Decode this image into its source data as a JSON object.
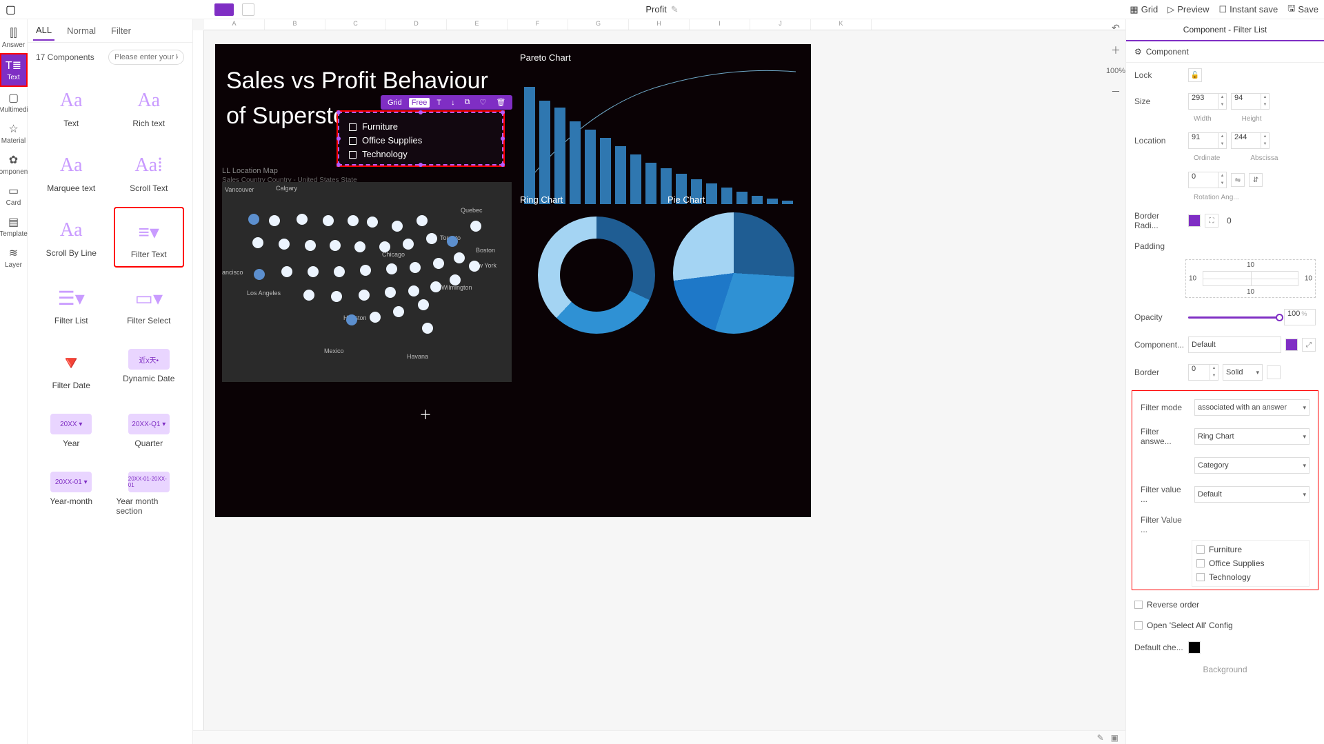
{
  "topbar": {
    "title": "Profit",
    "grid": "Grid",
    "preview": "Preview",
    "instant_save": "Instant save",
    "save": "Save"
  },
  "leftrail": {
    "answer": "Answer",
    "text": "Text",
    "multimedia": "Multimedi",
    "material": "Material",
    "component": "omponen",
    "card": "Card",
    "template": "Template",
    "layer": "Layer"
  },
  "leftpanel": {
    "tab_all": "ALL",
    "tab_normal": "Normal",
    "tab_filter": "Filter",
    "count": "17 Components",
    "search_placeholder": "Please enter your key",
    "items": [
      {
        "label": "Text"
      },
      {
        "label": "Rich text"
      },
      {
        "label": "Marquee text"
      },
      {
        "label": "Scroll Text"
      },
      {
        "label": "Scroll By Line"
      },
      {
        "label": "Filter Text"
      },
      {
        "label": "Filter List"
      },
      {
        "label": "Filter Select"
      },
      {
        "label": "Filter Date"
      },
      {
        "label": "Dynamic Date"
      },
      {
        "label": "Year"
      },
      {
        "label": "Quarter"
      },
      {
        "label": "Year-month"
      },
      {
        "label": "Year month section"
      }
    ],
    "thumbs": {
      "year": "20XX ▾",
      "quarter": "20XX-Q1 ▾",
      "yearmonth": "20XX-01 ▾",
      "ymsection": "20XX-01-20XX-01"
    }
  },
  "ruler": {
    "cols": [
      "A",
      "B",
      "C",
      "D",
      "E",
      "F",
      "G",
      "H",
      "I",
      "J",
      "K"
    ]
  },
  "canvas": {
    "title": "Sales vs Profit Behaviour of Superstore",
    "map_title": "LL Location Map",
    "map_sub": "Sales Country Country - United States State",
    "cities": {
      "vancouver": "Vancouver",
      "calgary": "Calgary",
      "quebec": "Quebec",
      "toronto": "Toronto",
      "boston": "Boston",
      "newyork": "New York",
      "chicago": "Chicago",
      "la": "Los Angeles",
      "francisco": "ancisco",
      "houston": "Houston",
      "mexico": "Mexico",
      "havana": "Havana",
      "wilmington": "Wilmington"
    },
    "filter_toolbar": {
      "grid": "Grid",
      "free": "Free"
    },
    "filter_items": [
      "Furniture",
      "Office Supplies",
      "Technology"
    ],
    "pareto_label": "Pareto Chart",
    "ring_label": "Ring Chart",
    "pie_label": "Pie Chart",
    "zoom": "100%"
  },
  "chart_data": {
    "pareto": {
      "type": "bar",
      "values": [
        170,
        150,
        140,
        120,
        108,
        96,
        84,
        72,
        60,
        52,
        44,
        36,
        30,
        24,
        18,
        12,
        8,
        5
      ],
      "cumulative_line": true
    },
    "ring": {
      "type": "pie",
      "segments": [
        32,
        30,
        38
      ]
    },
    "pie": {
      "type": "pie",
      "segments": [
        26,
        29,
        18,
        27
      ]
    }
  },
  "rightpanel": {
    "title": "Component - Filter List",
    "tab_component": "Component",
    "lock": "Lock",
    "size": "Size",
    "width_val": "293",
    "height_val": "94",
    "width_lbl": "Width",
    "height_lbl": "Height",
    "location": "Location",
    "ord_val": "91",
    "abs_val": "244",
    "ord_lbl": "Ordinate",
    "abs_lbl": "Abscissa",
    "rotation_val": "0",
    "rotation_lbl": "Rotation Ang...",
    "border_radius": "Border Radi...",
    "border_radius_val": "0",
    "padding": "Padding",
    "pad_t": "10",
    "pad_r": "10",
    "pad_b": "10",
    "pad_l": "10",
    "opacity": "Opacity",
    "opacity_val": "100",
    "component_style": "Component...",
    "component_style_val": "Default",
    "border": "Border",
    "border_val": "0",
    "border_style": "Solid",
    "filter_mode": "Filter mode",
    "filter_mode_val": "associated with an answer",
    "filter_answer": "Filter answe...",
    "filter_answer_val": "Ring Chart",
    "filter_answer_cat": "Category",
    "filter_value_source": "Filter value ...",
    "filter_value_source_val": "Default",
    "filter_value": "Filter Value ...",
    "filter_value_items": [
      "Furniture",
      "Office Supplies",
      "Technology"
    ],
    "reverse": "Reverse order",
    "selectall": "Open 'Select All' Config",
    "default_che": "Default che...",
    "background": "Background"
  }
}
